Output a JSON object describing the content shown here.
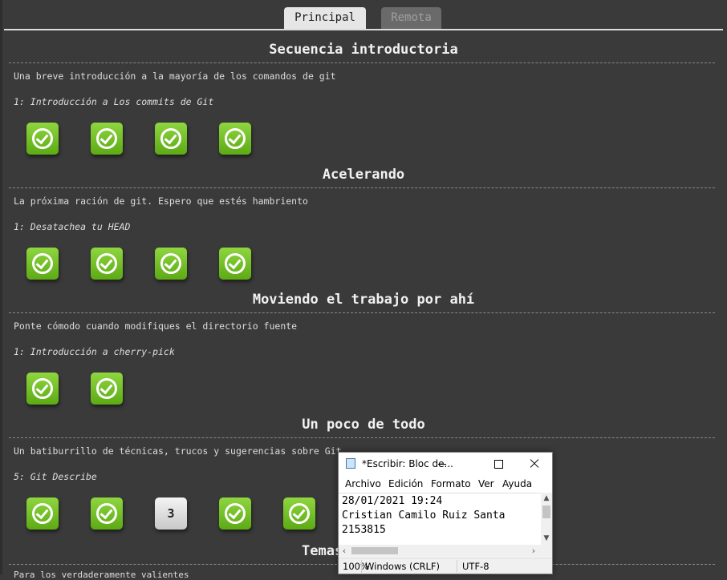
{
  "tabs": {
    "main": "Principal",
    "remote": "Remota"
  },
  "sections": [
    {
      "title": "Secuencia introductoria",
      "description": "Una breve introducción a la mayoría de los comandos de git",
      "current_level": "1: Introducción a Los commits de Git",
      "levels": [
        "done",
        "done",
        "done",
        "done"
      ]
    },
    {
      "title": "Acelerando",
      "description": "La próxima ración de git. Espero que estés hambriento",
      "current_level": "1: Desatachea tu HEAD",
      "levels": [
        "done",
        "done",
        "done",
        "done"
      ]
    },
    {
      "title": "Moviendo el trabajo por ahí",
      "description": "Ponte cómodo cuando modifiques el directorio fuente",
      "current_level": "1: Introducción a cherry-pick",
      "levels": [
        "done",
        "done"
      ]
    },
    {
      "title": "Un poco de todo",
      "description": "Un batiburrillo de técnicas, trucos y sugerencias sobre Git",
      "current_level": "5: Git Describe",
      "levels": [
        "done",
        "done",
        "3",
        "done",
        "done"
      ]
    }
  ],
  "partial_section": {
    "title": "Temas",
    "description": "Para los verdaderamente valientes"
  },
  "notepad": {
    "title": "*Escribir: Bloc de...",
    "menu": [
      "Archivo",
      "Edición",
      "Formato",
      "Ver",
      "Ayuda"
    ],
    "lines": [
      "28/01/2021 19:24",
      "Cristian Camilo Ruiz Santa",
      "2153815"
    ],
    "status": {
      "zoom": "100%",
      "line_ending": "Windows (CRLF)",
      "encoding": "UTF-8"
    }
  },
  "colors": {
    "background": "#3a3a3a",
    "level_done": "#6cc11f",
    "level_todo": "#e8e8e8"
  }
}
